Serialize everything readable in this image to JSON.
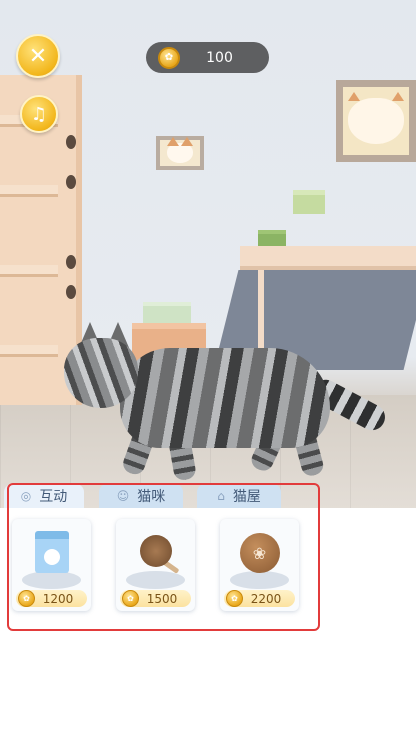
{
  "hud": {
    "close_icon": "close-x-icon",
    "music_icon": "music-note-icon",
    "coin_icon": "coin-icon",
    "coin_count": "100"
  },
  "tabs": [
    {
      "label": "互动",
      "icon": "yarn-ball-icon"
    },
    {
      "label": "猫咪",
      "icon": "cat-head-icon"
    },
    {
      "label": "猫屋",
      "icon": "cat-house-icon"
    }
  ],
  "items": [
    {
      "name_icon": "milk-carton-icon",
      "price": "1200"
    },
    {
      "name_icon": "catnip-lollipop-icon",
      "price": "1500"
    },
    {
      "name_icon": "paw-ball-icon",
      "price": "2200"
    }
  ],
  "colors": {
    "accent": "#f2b61b",
    "tab_bg": "#cfe1f2",
    "highlight_box": "#e23b3b"
  }
}
